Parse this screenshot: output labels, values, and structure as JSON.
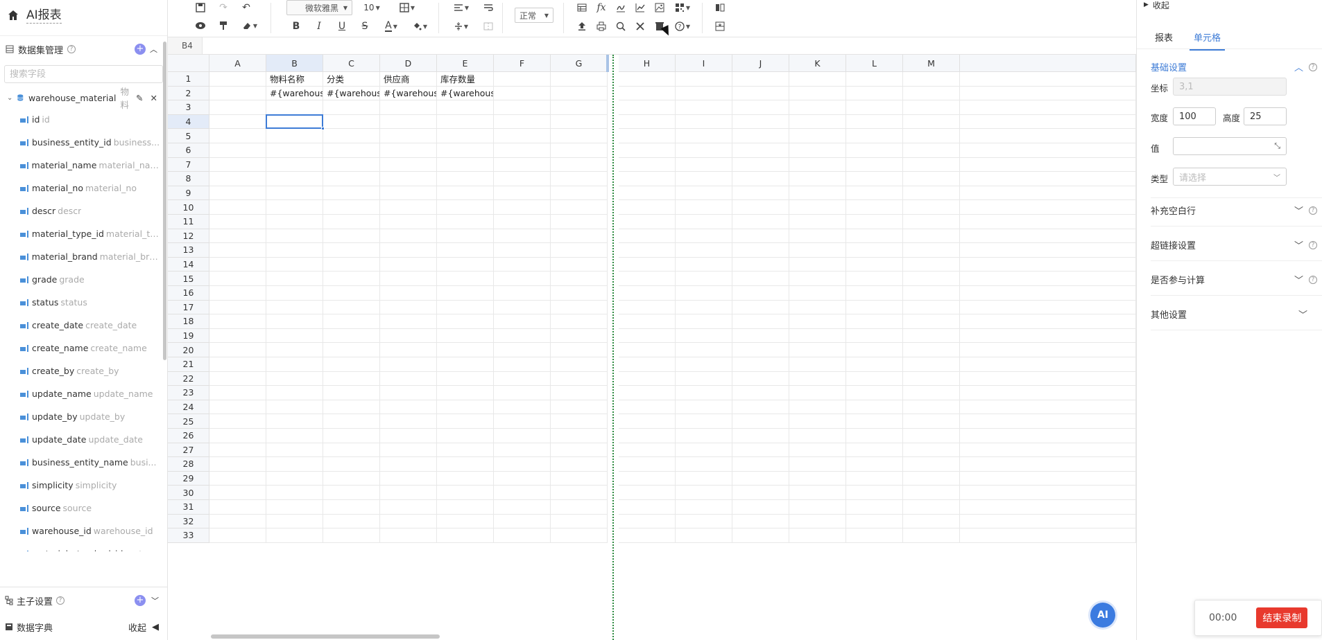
{
  "app": {
    "title": "AI报表"
  },
  "sidebar": {
    "dataset_title": "数据集管理",
    "search_placeholder": "搜索字段",
    "dataset": {
      "name": "warehouse_material",
      "alias": "物料"
    },
    "fields": [
      {
        "name": "id",
        "alias": "id"
      },
      {
        "name": "business_entity_id",
        "alias": "business..."
      },
      {
        "name": "material_name",
        "alias": "material_name"
      },
      {
        "name": "material_no",
        "alias": "material_no"
      },
      {
        "name": "descr",
        "alias": "descr"
      },
      {
        "name": "material_type_id",
        "alias": "material_ty..."
      },
      {
        "name": "material_brand",
        "alias": "material_bra..."
      },
      {
        "name": "grade",
        "alias": "grade"
      },
      {
        "name": "status",
        "alias": "status"
      },
      {
        "name": "create_date",
        "alias": "create_date"
      },
      {
        "name": "create_name",
        "alias": "create_name"
      },
      {
        "name": "create_by",
        "alias": "create_by"
      },
      {
        "name": "update_name",
        "alias": "update_name"
      },
      {
        "name": "update_by",
        "alias": "update_by"
      },
      {
        "name": "update_date",
        "alias": "update_date"
      },
      {
        "name": "business_entity_name",
        "alias": "busi..."
      },
      {
        "name": "simplicity",
        "alias": "simplicity"
      },
      {
        "name": "source",
        "alias": "source"
      },
      {
        "name": "warehouse_id",
        "alias": "warehouse_id"
      },
      {
        "name": "material_standard_id",
        "alias": "materi..."
      }
    ],
    "bottom": {
      "master_sub": "主子设置",
      "dictionary": "数据字典",
      "collapse": "收起"
    }
  },
  "toolbar": {
    "font_family": "微软雅黑",
    "font_size": "10",
    "zoom_mode": "正常",
    "icons": [
      "save-icon",
      "redo-icon",
      "undo-icon",
      "preview-icon",
      "format-painter-icon",
      "eraser-icon",
      "bold-icon",
      "italic-icon",
      "underline-icon",
      "strikethrough-icon",
      "font-color-icon",
      "fill-color-icon",
      "border-icon",
      "align-horizontal-icon",
      "wrap-text-icon",
      "align-vertical-icon",
      "merge-cells-icon",
      "table-icon",
      "function-icon",
      "signature-icon",
      "line-chart-icon",
      "image-icon",
      "qrcode-icon",
      "upload-icon",
      "print-icon",
      "search-icon",
      "tools-icon",
      "paste-icon",
      "help-icon",
      "freeze-icon",
      "split-icon"
    ]
  },
  "formula_bar": {
    "cell_ref": "B4"
  },
  "grid": {
    "columns": [
      "A",
      "B",
      "C",
      "D",
      "E",
      "F",
      "G",
      "H",
      "I",
      "J",
      "K",
      "L",
      "M"
    ],
    "selected_column": "B",
    "row_count": 33,
    "selected_row": 4,
    "cells": [
      {
        "ref": "B1",
        "value": "物料名称"
      },
      {
        "ref": "C1",
        "value": "分类"
      },
      {
        "ref": "D1",
        "value": "供应商"
      },
      {
        "ref": "E1",
        "value": "库存数量"
      },
      {
        "ref": "B2",
        "value": "#{warehouse_"
      },
      {
        "ref": "C2",
        "value": "#{warehouse_"
      },
      {
        "ref": "D2",
        "value": "#{warehouse_"
      },
      {
        "ref": "E2",
        "value": "#{warehouse_"
      }
    ],
    "ai_badge": "AI"
  },
  "panel": {
    "collapse": "收起",
    "tabs": [
      "报表",
      "单元格"
    ],
    "active_tab": "单元格",
    "basic": {
      "title": "基础设置",
      "coord_label": "坐标",
      "coord_value": "3,1",
      "width_label": "宽度",
      "width_value": "100",
      "height_label": "高度",
      "height_value": "25",
      "value_label": "值",
      "type_label": "类型",
      "type_placeholder": "请选择"
    },
    "sections": [
      "补充空白行",
      "超链接设置",
      "是否参与计算",
      "其他设置"
    ]
  },
  "recording": {
    "time": "00:00",
    "stop_label": "结束录制"
  },
  "colors": {
    "accent": "#3d7bd6",
    "stop_red": "#e8392d",
    "badge": "#3b7be0"
  }
}
